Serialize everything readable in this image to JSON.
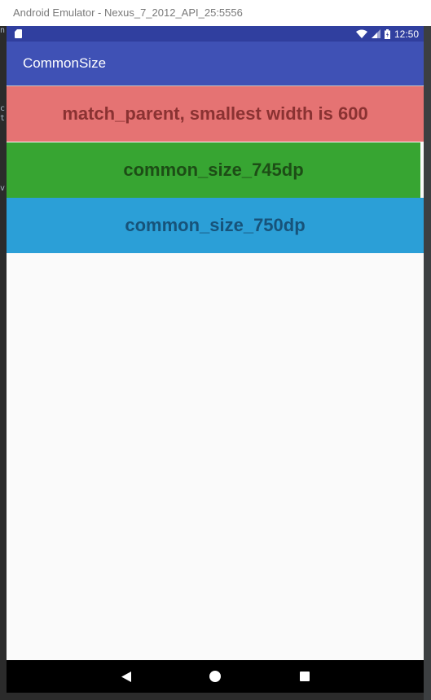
{
  "window": {
    "title": "Android Emulator - Nexus_7_2012_API_25:5556"
  },
  "status_bar": {
    "time": "12:50"
  },
  "app_bar": {
    "title": "CommonSize"
  },
  "blocks": [
    {
      "label": "match_parent, smallest width is 600",
      "color": "#e57373"
    },
    {
      "label": "common_size_745dp",
      "color": "#37a532"
    },
    {
      "label": "common_size_750dp",
      "color": "#2b9fd7"
    }
  ],
  "nav_bar": {
    "buttons": [
      "back",
      "home",
      "recents"
    ]
  }
}
